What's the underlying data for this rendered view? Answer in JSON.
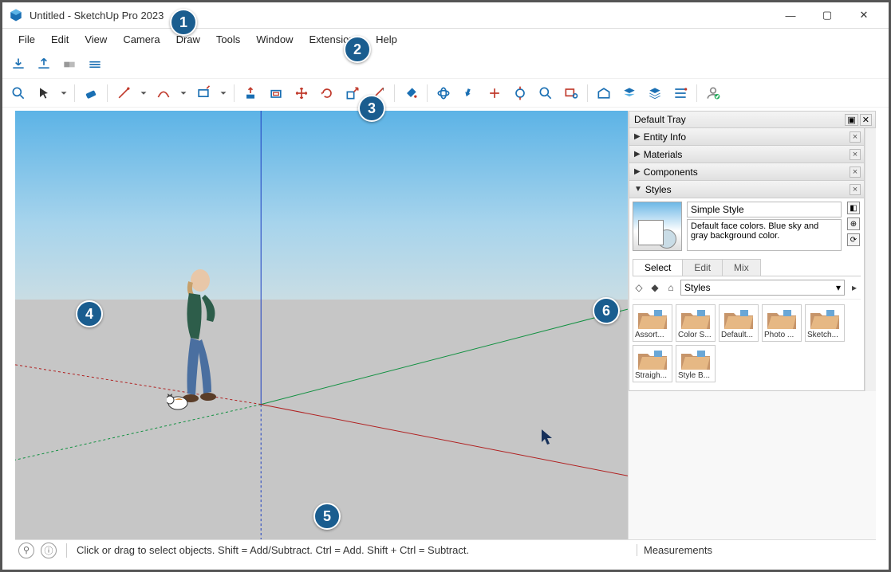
{
  "window": {
    "title": "Untitled - SketchUp Pro 2023"
  },
  "menus": [
    "File",
    "Edit",
    "View",
    "Camera",
    "Draw",
    "Tools",
    "Window",
    "Extensions",
    "Help"
  ],
  "toolbar_top": [
    "warehouse-download",
    "warehouse-upload",
    "extension-manager",
    "extension-settings"
  ],
  "toolbar_main": [
    "search",
    "select",
    "select-dropdown",
    "sep",
    "eraser",
    "sep",
    "line",
    "line-dropdown",
    "arc",
    "arc-dropdown",
    "rectangle",
    "rectangle-dropdown",
    "sep",
    "push-pull",
    "offset",
    "move",
    "rotate",
    "scale",
    "tape-measure",
    "sep",
    "paint-bucket",
    "sep",
    "orbit",
    "pan",
    "zoom-extents",
    "rotate-view",
    "zoom",
    "zoom-window",
    "sep",
    "3d-warehouse",
    "layers",
    "outliner",
    "tags",
    "sep",
    "account"
  ],
  "tray": {
    "title": "Default Tray",
    "panels": [
      {
        "label": "Entity Info",
        "expanded": false
      },
      {
        "label": "Materials",
        "expanded": false
      },
      {
        "label": "Components",
        "expanded": false
      },
      {
        "label": "Styles",
        "expanded": true
      }
    ],
    "styles": {
      "name": "Simple Style",
      "description": "Default face colors. Blue sky and gray background color.",
      "tabs": [
        "Select",
        "Edit",
        "Mix"
      ],
      "active_tab": "Select",
      "breadcrumb": "Styles",
      "folders": [
        "Assort...",
        "Color S...",
        "Default...",
        "Photo ...",
        "Sketch...",
        "Straigh...",
        "Style B..."
      ]
    }
  },
  "status": {
    "hint": "Click or drag to select objects. Shift = Add/Subtract. Ctrl = Add. Shift + Ctrl = Subtract.",
    "measurements_label": "Measurements"
  },
  "callouts": [
    "1",
    "2",
    "3",
    "4",
    "5",
    "6"
  ]
}
